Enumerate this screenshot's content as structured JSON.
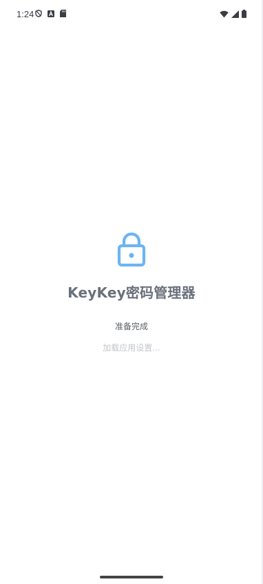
{
  "status_bar": {
    "time": "1:24",
    "left_icons": [
      "vpn-shield-icon",
      "autofill-a-icon",
      "sd-card-icon"
    ],
    "right_icons": [
      "wifi-icon",
      "cell-signal-icon",
      "battery-icon"
    ]
  },
  "splash": {
    "icon": "lock-icon",
    "accent_color": "#6db4f2",
    "app_title": "KeyKey密码管理器",
    "status": "准备完成",
    "loading_message": "加载应用设置..."
  }
}
